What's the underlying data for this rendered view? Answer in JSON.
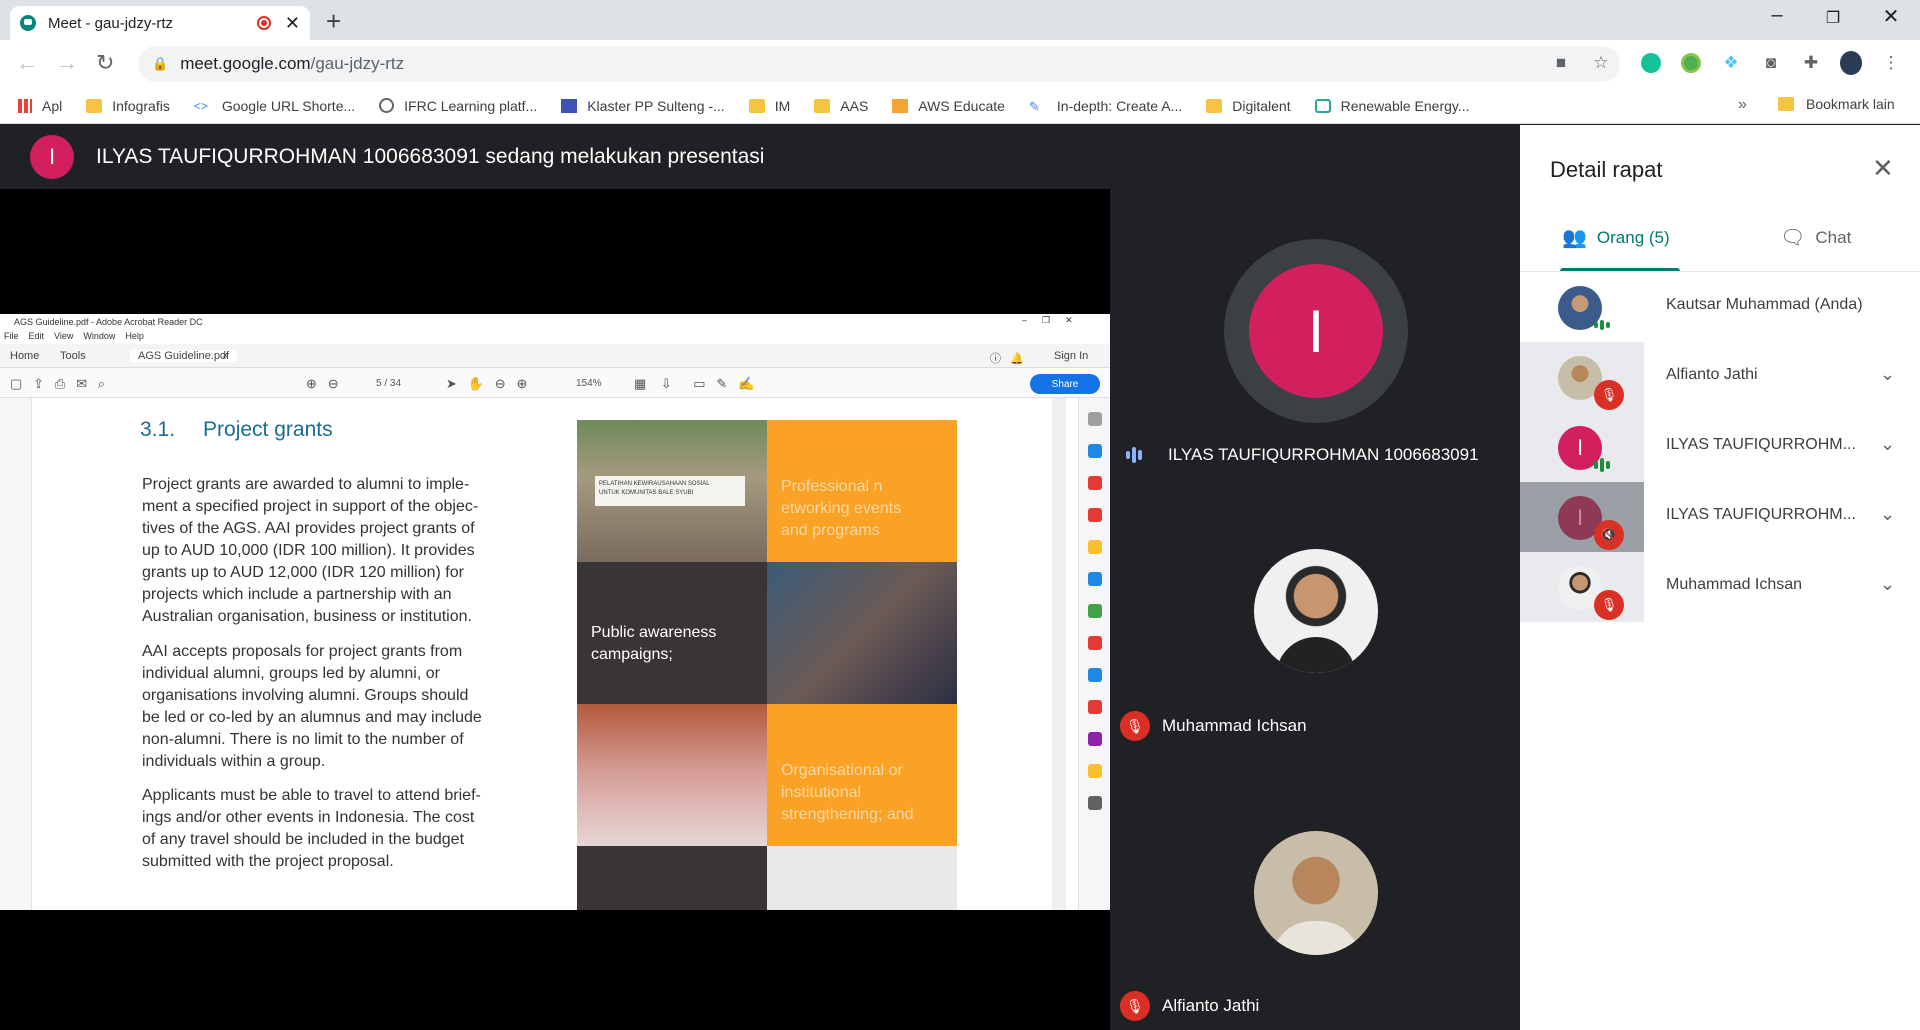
{
  "browser": {
    "tab_title": "Meet - gau-jdzy-rtz",
    "new_tab": "+",
    "url_domain": "meet.google.com",
    "url_path": "/gau-jdzy-rtz",
    "window_controls": {
      "minimize": "–",
      "restore": "❐",
      "close": "✕"
    },
    "bookmarks": [
      "Apl",
      "Infografis",
      "Google URL Shorte...",
      "IFRC Learning platf...",
      "Klaster PP Sulteng -...",
      "IM",
      "AAS",
      "AWS Educate",
      "In-depth: Create A...",
      "Digitalent",
      "Renewable Energy..."
    ],
    "bookmarks_more": "»",
    "other_bookmarks": "Bookmark lain"
  },
  "meet": {
    "presenter_initial": "I",
    "presenting_text": "ILYAS TAUFIQURROHMAN 1006683091 sedang melakukan presentasi",
    "tiles": [
      {
        "name": "ILYAS TAUFIQURROHMAN 1006683091",
        "initial": "I",
        "status": "speaking"
      },
      {
        "name": "Muhammad Ichsan",
        "status": "muted"
      },
      {
        "name": "Alfianto Jathi",
        "status": "muted"
      }
    ]
  },
  "shared_screen": {
    "window_title": "AGS Guideline.pdf - Adobe Acrobat Reader DC",
    "menu": [
      "File",
      "Edit",
      "View",
      "Window",
      "Help"
    ],
    "tabs": {
      "home": "Home",
      "tools": "Tools",
      "doc": "AGS Guideline.pdf",
      "sign_in": "Sign In"
    },
    "page_indicator": "5 / 34",
    "zoom": "154%",
    "share": "Share",
    "heading_num": "3.1.",
    "heading": "Project grants",
    "para1": "Project grants are awarded to alumni to imple-\nment a specified project in support of the objec-\ntives of the AGS. AAI provides project grants of\nup to AUD 10,000 (IDR 100 million).  It provides\ngrants up to AUD 12,000 (IDR 120 million) for\nprojects which include a partnership with an\nAustralian organisation, business or institution.",
    "para2": "AAI accepts proposals for project grants from\nindividual alumni, groups led by alumni, or\norganisations involving alumni.  Groups should\nbe led or co-led by an alumnus and may include\nnon-alumni.  There is no limit to the number of\nindividuals within a group.",
    "para3": "Applicants must be able to travel to attend brief-\nings and/or other events in Indonesia.  The cost\nof any travel should be included in the budget\nsubmitted with the project proposal.",
    "banner": "PELATIHAN KEWIRAUSAHAAN SOSIAL\nUNTUK KOMUNITAS BALE SYUBI",
    "cell1": "Professional n\networking events\nand programs",
    "cell2": "Public awareness\ncampaigns;",
    "cell3": "Organisational or\ninstitutional\nstrengthening; and"
  },
  "panel": {
    "title": "Detail rapat",
    "close": "✕",
    "tab_people": "Orang (5)",
    "tab_chat": "Chat",
    "people": [
      {
        "name": "Kautsar Muhammad (Anda)",
        "status": "speaking"
      },
      {
        "name": "Alfianto Jathi",
        "status": "muted"
      },
      {
        "name": "ILYAS TAUFIQURROHM...",
        "status": "speaking",
        "initial": "I"
      },
      {
        "name": "ILYAS TAUFIQURROHM...",
        "status": "muted",
        "initial": "I"
      },
      {
        "name": "Muhammad Ichsan",
        "status": "muted"
      }
    ]
  },
  "colors": {
    "accent": "#00796b",
    "avatar": "#d21f5e",
    "muted": "#d93025",
    "orange": "#f9a225"
  }
}
